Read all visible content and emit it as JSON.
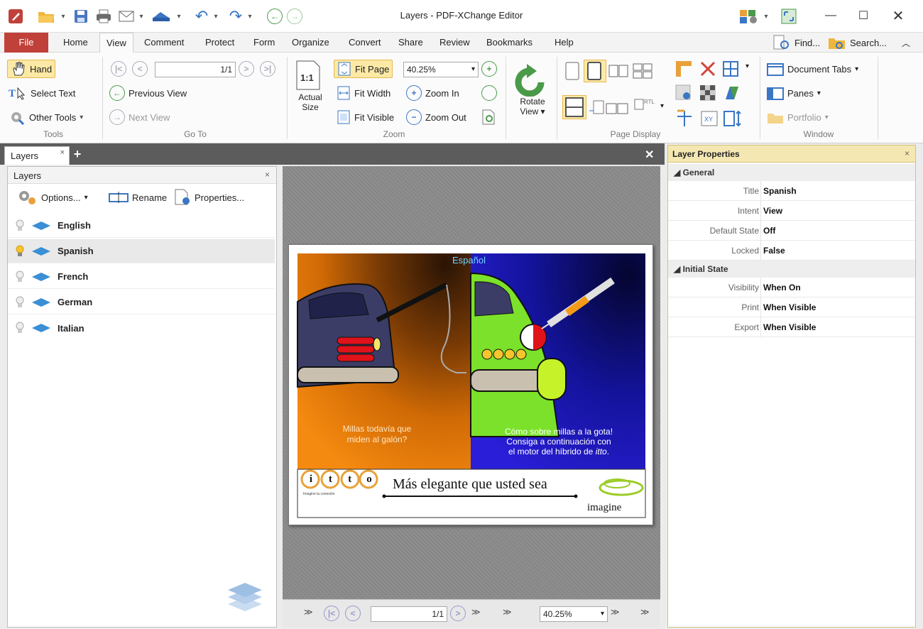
{
  "window": {
    "title": "Layers - PDF-XChange Editor"
  },
  "menu": {
    "tabs": [
      "File",
      "Home",
      "View",
      "Comment",
      "Protect",
      "Form",
      "Organize",
      "Convert",
      "Share",
      "Review",
      "Bookmarks",
      "Help"
    ],
    "find": "Find...",
    "search": "Search..."
  },
  "ribbon": {
    "tools": {
      "hand": "Hand",
      "select_text": "Select Text",
      "other_tools": "Other Tools",
      "label": "Tools"
    },
    "goto": {
      "page_value": "1/1",
      "previous_view": "Previous View",
      "next_view": "Next View",
      "label": "Go To"
    },
    "zoom": {
      "actual_size_1": "Actual",
      "actual_size_2": "Size",
      "fit_page": "Fit Page",
      "fit_width": "Fit Width",
      "fit_visible": "Fit Visible",
      "zoom_value": "40.25%",
      "zoom_in": "Zoom In",
      "zoom_out": "Zoom Out",
      "label": "Zoom"
    },
    "rotate": {
      "label1": "Rotate",
      "label2": "View"
    },
    "page_display": {
      "label": "Page Display"
    },
    "window": {
      "document_tabs": "Document Tabs",
      "panes": "Panes",
      "portfolio": "Portfolio",
      "label": "Window"
    }
  },
  "doc_tab": {
    "label": "Layers"
  },
  "layers_pane": {
    "title": "Layers",
    "options": "Options...",
    "rename": "Rename",
    "properties": "Properties...",
    "layers": [
      {
        "name": "English",
        "selected": false
      },
      {
        "name": "Spanish",
        "selected": true
      },
      {
        "name": "French",
        "selected": false
      },
      {
        "name": "German",
        "selected": false
      },
      {
        "name": "Italian",
        "selected": false
      }
    ]
  },
  "page": {
    "heading": "Español",
    "left_text_1": "Millas todavía que",
    "left_text_2": "miden al galón?",
    "right_text_1": "Cómo sobre millas a la gota!",
    "right_text_2": "Consiga a continuación con",
    "right_text_3": "el motor del híbrido de ",
    "right_text_brand": "itto",
    "right_text_end": ".",
    "logo_letters": [
      "i",
      "t",
      "t",
      "o"
    ],
    "logo_tag": "Imagine la conexión",
    "slogan": "Más elegante que usted sea",
    "brand": "imagine"
  },
  "navbar": {
    "page_value": "1/1",
    "zoom_value": "40.25%"
  },
  "properties": {
    "title": "Layer Properties",
    "general_label": "General",
    "general": [
      {
        "key": "Title",
        "value": "Spanish"
      },
      {
        "key": "Intent",
        "value": "View"
      },
      {
        "key": "Default State",
        "value": "Off"
      },
      {
        "key": "Locked",
        "value": "False"
      }
    ],
    "initial_label": "Initial State",
    "initial": [
      {
        "key": "Visibility",
        "value": "When On"
      },
      {
        "key": "Print",
        "value": "When Visible"
      },
      {
        "key": "Export",
        "value": "When Visible"
      }
    ]
  },
  "colors": {
    "file_tab": "#c0413a",
    "selected": "#fde9a6",
    "accent": "#3a76c4"
  }
}
